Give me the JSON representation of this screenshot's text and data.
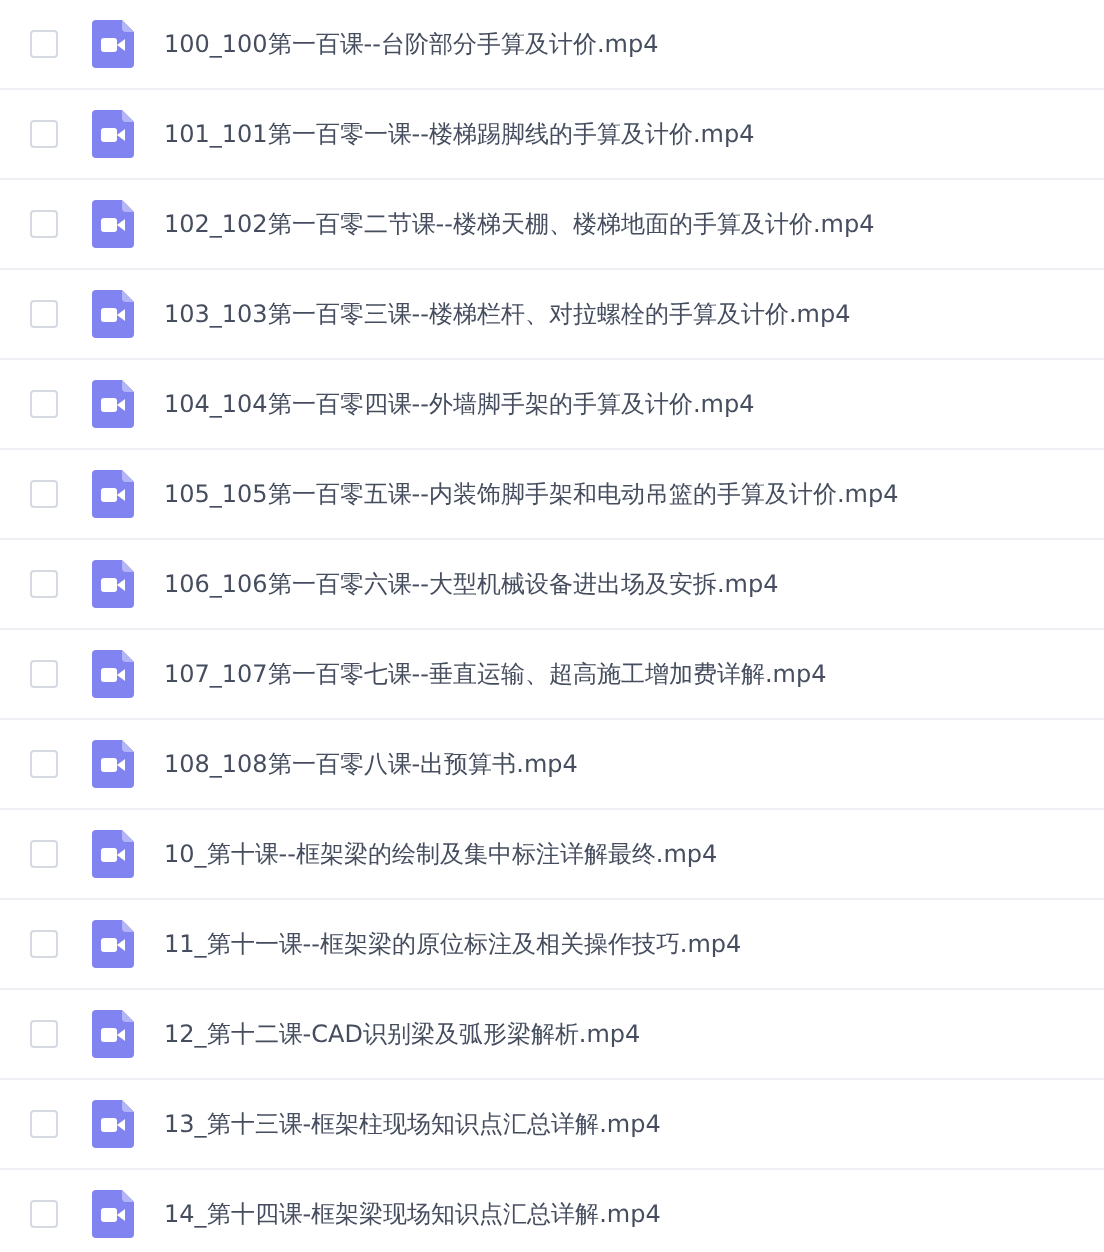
{
  "files": [
    {
      "name": "100_100第一百课--台阶部分手算及计价.mp4",
      "checked": false
    },
    {
      "name": "101_101第一百零一课--楼梯踢脚线的手算及计价.mp4",
      "checked": false
    },
    {
      "name": "102_102第一百零二节课--楼梯天棚、楼梯地面的手算及计价.mp4",
      "checked": false
    },
    {
      "name": "103_103第一百零三课--楼梯栏杆、对拉螺栓的手算及计价.mp4",
      "checked": false
    },
    {
      "name": "104_104第一百零四课--外墙脚手架的手算及计价.mp4",
      "checked": false
    },
    {
      "name": "105_105第一百零五课--内装饰脚手架和电动吊篮的手算及计价.mp4",
      "checked": false
    },
    {
      "name": "106_106第一百零六课--大型机械设备进出场及安拆.mp4",
      "checked": false
    },
    {
      "name": "107_107第一百零七课--垂直运输、超高施工增加费详解.mp4",
      "checked": false
    },
    {
      "name": "108_108第一百零八课-出预算书.mp4",
      "checked": false
    },
    {
      "name": "10_第十课--框架梁的绘制及集中标注详解最终.mp4",
      "checked": false
    },
    {
      "name": "11_第十一课--框架梁的原位标注及相关操作技巧.mp4",
      "checked": false
    },
    {
      "name": "12_第十二课-CAD识别梁及弧形梁解析.mp4",
      "checked": false
    },
    {
      "name": "13_第十三课-框架柱现场知识点汇总详解.mp4",
      "checked": false
    },
    {
      "name": "14_第十四课-框架梁现场知识点汇总详解.mp4",
      "checked": false
    }
  ]
}
